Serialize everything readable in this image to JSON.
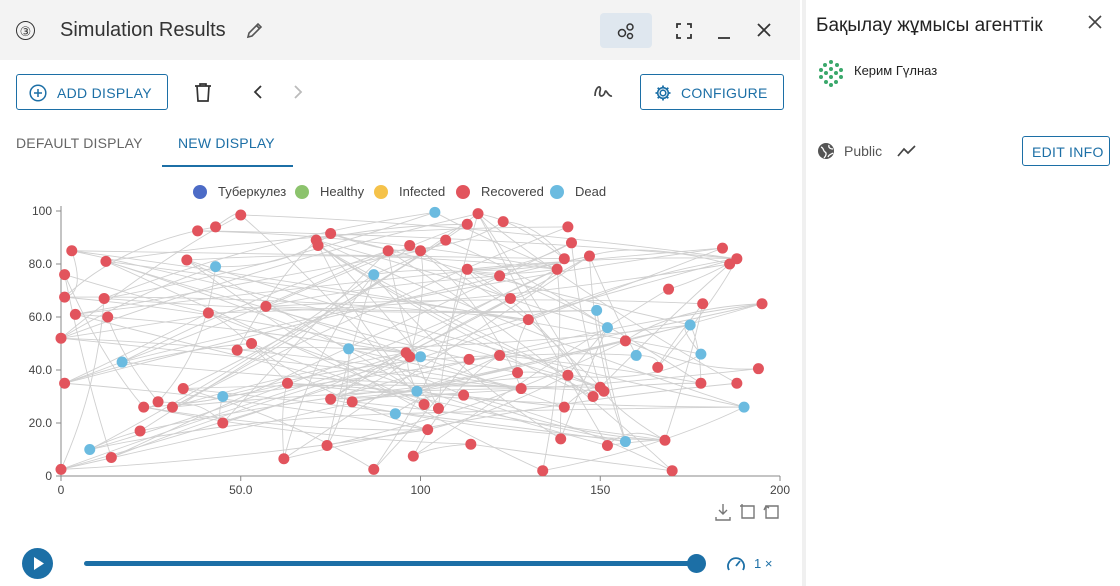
{
  "header": {
    "step": "③",
    "title": "Simulation Results"
  },
  "toolbar": {
    "add_display": "ADD DISPLAY",
    "configure": "CONFIGURE"
  },
  "tabs": [
    {
      "label": "DEFAULT DISPLAY",
      "active": false
    },
    {
      "label": "NEW DISPLAY",
      "active": true
    }
  ],
  "chart_data": {
    "type": "scatter",
    "title": "",
    "xlabel": "",
    "ylabel": "",
    "xlim": [
      0,
      200
    ],
    "ylim": [
      0,
      100
    ],
    "x_ticks": [
      "0",
      "50.0",
      "100",
      "150",
      "200"
    ],
    "y_ticks": [
      "0",
      "20.0",
      "40.0",
      "60.0",
      "80.0",
      "100"
    ],
    "legend": [
      {
        "name": "Туберкулез",
        "color": "#4c6bc6"
      },
      {
        "name": "Healthy",
        "color": "#8cc36d"
      },
      {
        "name": "Infected",
        "color": "#f5c24a"
      },
      {
        "name": "Recovered",
        "color": "#e2545d"
      },
      {
        "name": "Dead",
        "color": "#6bbbe0"
      }
    ],
    "legend_position": "top",
    "grid": false,
    "series": [
      {
        "name": "Recovered",
        "color": "#e2545d",
        "points": [
          [
            0,
            52
          ],
          [
            0,
            2.5
          ],
          [
            1,
            35
          ],
          [
            1,
            67.5
          ],
          [
            1,
            76
          ],
          [
            3,
            85
          ],
          [
            4,
            61
          ],
          [
            12,
            67
          ],
          [
            12.5,
            81
          ],
          [
            13,
            60
          ],
          [
            14,
            7
          ],
          [
            22,
            17
          ],
          [
            23,
            26
          ],
          [
            27,
            28
          ],
          [
            31,
            26
          ],
          [
            34,
            33
          ],
          [
            35,
            81.5
          ],
          [
            38,
            92.5
          ],
          [
            41,
            61.5
          ],
          [
            43,
            94
          ],
          [
            45,
            20
          ],
          [
            49,
            47.5
          ],
          [
            50,
            98.5
          ],
          [
            53,
            50
          ],
          [
            57,
            64
          ],
          [
            62,
            6.5
          ],
          [
            63,
            35
          ],
          [
            71,
            89
          ],
          [
            71.5,
            87
          ],
          [
            74,
            11.5
          ],
          [
            75,
            29
          ],
          [
            75,
            91.5
          ],
          [
            81,
            28
          ],
          [
            87,
            2.5
          ],
          [
            91,
            85
          ],
          [
            96,
            46.5
          ],
          [
            97,
            45
          ],
          [
            97,
            87
          ],
          [
            98,
            7.5
          ],
          [
            100,
            85
          ],
          [
            101,
            27
          ],
          [
            102,
            17.5
          ],
          [
            105,
            25.5
          ],
          [
            107,
            89
          ],
          [
            112,
            30.5
          ],
          [
            113,
            95
          ],
          [
            113,
            78
          ],
          [
            113.5,
            44
          ],
          [
            114,
            12
          ],
          [
            116,
            99
          ],
          [
            122,
            45.5
          ],
          [
            122,
            75.5
          ],
          [
            123,
            96
          ],
          [
            125,
            67
          ],
          [
            127,
            39
          ],
          [
            128,
            33
          ],
          [
            130,
            59
          ],
          [
            134,
            2
          ],
          [
            138,
            78
          ],
          [
            139,
            14
          ],
          [
            140,
            26
          ],
          [
            140,
            82
          ],
          [
            141,
            94
          ],
          [
            141,
            38
          ],
          [
            142,
            88
          ],
          [
            147,
            83
          ],
          [
            148,
            30
          ],
          [
            150,
            33.5
          ],
          [
            151,
            32
          ],
          [
            152,
            11.5
          ],
          [
            157,
            51
          ],
          [
            166,
            41
          ],
          [
            168,
            13.5
          ],
          [
            169,
            70.5
          ],
          [
            170,
            2
          ],
          [
            178,
            35
          ],
          [
            178.5,
            65
          ],
          [
            184,
            86
          ],
          [
            186,
            80
          ],
          [
            188,
            82
          ],
          [
            188,
            35
          ],
          [
            194,
            40.5
          ],
          [
            195,
            65
          ]
        ]
      },
      {
        "name": "Dead",
        "color": "#6bbbe0",
        "points": [
          [
            8,
            10
          ],
          [
            17,
            43
          ],
          [
            43,
            79
          ],
          [
            45,
            30
          ],
          [
            80,
            48
          ],
          [
            87,
            76
          ],
          [
            93,
            23.5
          ],
          [
            99,
            32
          ],
          [
            100,
            45
          ],
          [
            104,
            99.5
          ],
          [
            149,
            62.5
          ],
          [
            152,
            56
          ],
          [
            157,
            13
          ],
          [
            160,
            45.5
          ],
          [
            175,
            57
          ],
          [
            178,
            46
          ],
          [
            190,
            26
          ]
        ]
      }
    ]
  },
  "playback": {
    "speed": "1 ×",
    "progress": 1.0
  },
  "info_panel": {
    "title": "Бақылау жұмысы агенттік",
    "author": "Керим Гүлназ",
    "visibility": "Public",
    "edit_label": "EDIT INFO"
  }
}
